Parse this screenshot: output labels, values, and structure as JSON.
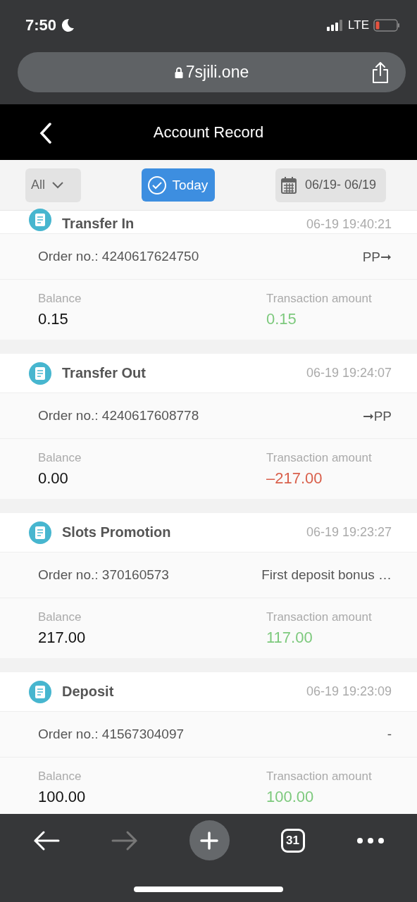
{
  "status_bar": {
    "time": "7:50",
    "network": "LTE"
  },
  "browser": {
    "url": "7sjili.one",
    "tab_count": "31"
  },
  "header": {
    "title": "Account Record"
  },
  "filters": {
    "type": "All",
    "today": {
      "label": "Today",
      "selected": true
    },
    "date_range": "06/19- 06/19"
  },
  "records": [
    {
      "title": "Transfer In",
      "time": "06-19 19:40:21",
      "order_label": "Order no.:",
      "order_no": "4240617624750",
      "note": "PP➞",
      "balance_label": "Balance",
      "balance": "0.15",
      "amount_label": "Transaction amount",
      "amount": "0.15",
      "color": "#7dc97d",
      "partial": true
    },
    {
      "title": "Transfer Out",
      "time": "06-19 19:24:07",
      "order_label": "Order no.:",
      "order_no": "4240617608778",
      "note": "➞PP",
      "balance_label": "Balance",
      "balance": "0.00",
      "amount_label": "Transaction amount",
      "amount": "–217.00",
      "color": "#d9604c",
      "partial": false
    },
    {
      "title": "Slots Promotion",
      "time": "06-19 19:23:27",
      "order_label": "Order no.:",
      "order_no": "370160573",
      "note": "First deposit bonus …",
      "balance_label": "Balance",
      "balance": "217.00",
      "amount_label": "Transaction amount",
      "amount": "117.00",
      "color": "#7dc97d",
      "partial": false
    },
    {
      "title": "Deposit",
      "time": "06-19 19:23:09",
      "order_label": "Order no.:",
      "order_no": "41567304097",
      "note": "-",
      "balance_label": "Balance",
      "balance": "100.00",
      "amount_label": "Transaction amount",
      "amount": "100.00",
      "color": "#7dc97d",
      "partial": false
    }
  ]
}
